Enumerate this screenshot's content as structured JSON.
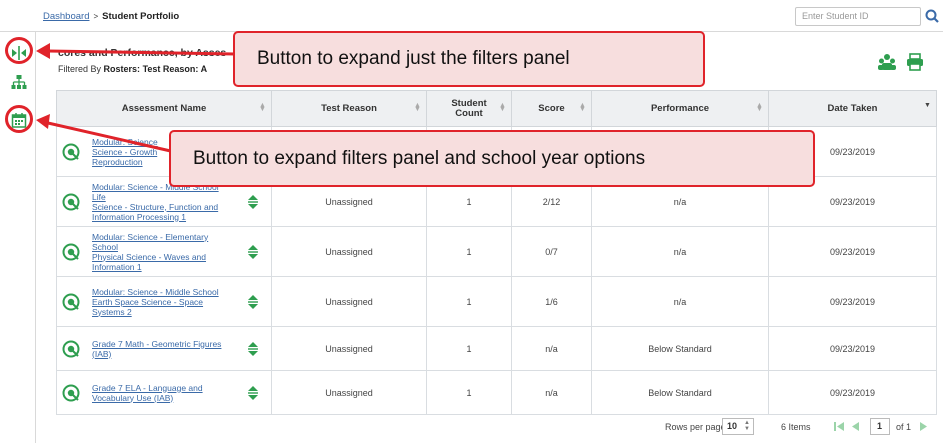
{
  "breadcrumb": {
    "root": "Dashboard",
    "separator": ">",
    "current": "Student Portfolio"
  },
  "search": {
    "placeholder": "Enter Student ID",
    "icon": "search-icon"
  },
  "section": {
    "title": "cores and Performance, by Asses",
    "filtered_by_label": "Filtered By",
    "rosters_label": "Rosters:",
    "test_reason_label": "Test Reason: A"
  },
  "table": {
    "columns": [
      "Assessment Name",
      "Test Reason",
      "Student Count",
      "Score",
      "Performance",
      "Date Taken"
    ],
    "rows": [
      {
        "name": "Modular: Science - ... Science - Growth ... Reproduction ...",
        "name_lines": [
          "Modular: Science",
          "Science - Growth",
          "Reproduction"
        ],
        "test_reason": "",
        "count": "",
        "score": "",
        "performance": "",
        "date": "09/23/2019"
      },
      {
        "name_lines": [
          "Modular: Science - Middle School Life",
          "Science - Structure, Function and",
          "Information Processing 1"
        ],
        "test_reason": "Unassigned",
        "count": "1",
        "score": "2/12",
        "performance": "n/a",
        "date": "09/23/2019"
      },
      {
        "name_lines": [
          "Modular: Science - Elementary School",
          "Physical Science - Waves and",
          "Information 1"
        ],
        "test_reason": "Unassigned",
        "count": "1",
        "score": "0/7",
        "performance": "n/a",
        "date": "09/23/2019"
      },
      {
        "name_lines": [
          "Modular: Science - Middle School",
          "Earth Space Science - Space",
          "Systems 2"
        ],
        "test_reason": "Unassigned",
        "count": "1",
        "score": "1/6",
        "performance": "n/a",
        "date": "09/23/2019"
      },
      {
        "name_lines": [
          "Grade 7 Math - Geometric Figures",
          "(IAB)"
        ],
        "test_reason": "Unassigned",
        "count": "1",
        "score": "n/a",
        "performance": "Below Standard",
        "date": "09/23/2019"
      },
      {
        "name_lines": [
          "Grade 7 ELA - Language and",
          "Vocabulary Use (IAB)"
        ],
        "test_reason": "Unassigned",
        "count": "1",
        "score": "n/a",
        "performance": "Below Standard",
        "date": "09/23/2019"
      }
    ]
  },
  "pagination": {
    "rows_per_page_label": "Rows per page:",
    "rows_per_page": "10",
    "items": "6 Items",
    "page": "1",
    "of_label": "of 1"
  },
  "callouts": {
    "filters": "Button to expand just the filters panel",
    "filters_year": "Button to expand filters panel and school year options"
  },
  "colors": {
    "link": "#3a6aa8",
    "green": "#2e9e4f",
    "callout_border": "#e0232a",
    "callout_fill": "#f7dede",
    "header_bg": "#eef0f2"
  }
}
